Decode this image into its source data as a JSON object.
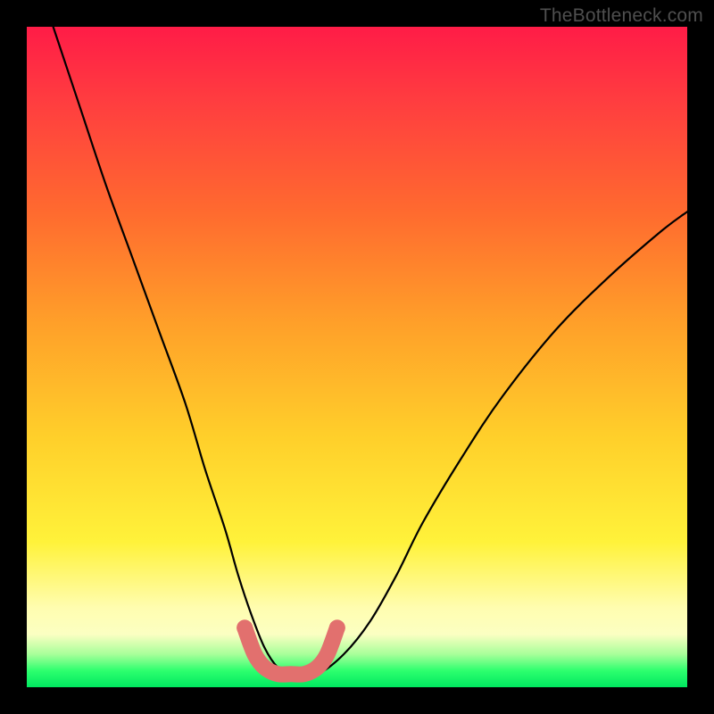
{
  "watermark": "TheBottleneck.com",
  "chart_data": {
    "type": "line",
    "title": "",
    "xlabel": "",
    "ylabel": "",
    "xlim": [
      0,
      100
    ],
    "ylim": [
      0,
      100
    ],
    "series": [
      {
        "name": "bottleneck-curve",
        "x": [
          4,
          8,
          12,
          16,
          20,
          24,
          27,
          30,
          32,
          34,
          36,
          38,
          40,
          44,
          48,
          52,
          56,
          60,
          66,
          72,
          80,
          88,
          96,
          100
        ],
        "values": [
          100,
          88,
          76,
          65,
          54,
          43,
          33,
          24,
          17,
          11,
          6,
          3,
          2,
          2,
          5,
          10,
          17,
          25,
          35,
          44,
          54,
          62,
          69,
          72
        ]
      },
      {
        "name": "trough-marker",
        "x": [
          33,
          34.5,
          36,
          38,
          40,
          42,
          44,
          45.5,
          47
        ],
        "values": [
          9,
          5,
          3,
          2,
          2,
          2,
          3,
          5,
          9
        ]
      }
    ],
    "gradient_stops": [
      {
        "pos": 0,
        "color": "#ff1c47"
      },
      {
        "pos": 50,
        "color": "#ffc82a"
      },
      {
        "pos": 88,
        "color": "#fffdb0"
      },
      {
        "pos": 100,
        "color": "#00e860"
      }
    ]
  }
}
